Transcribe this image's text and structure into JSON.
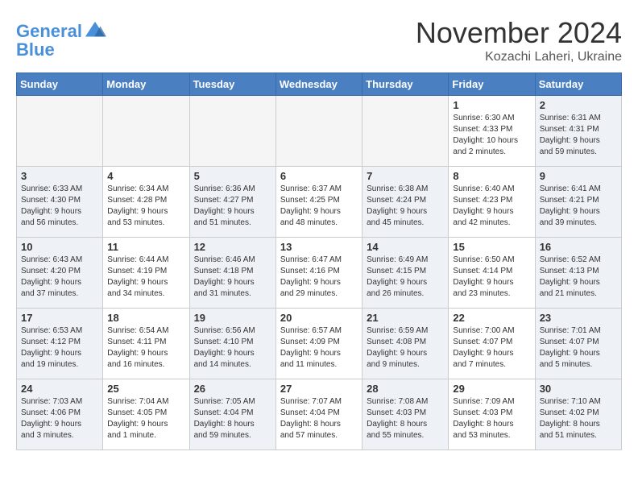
{
  "header": {
    "logo_line1": "General",
    "logo_line2": "Blue",
    "title": "November 2024",
    "subtitle": "Kozachi Laheri, Ukraine"
  },
  "weekdays": [
    "Sunday",
    "Monday",
    "Tuesday",
    "Wednesday",
    "Thursday",
    "Friday",
    "Saturday"
  ],
  "weeks": [
    [
      {
        "day": "",
        "empty": true
      },
      {
        "day": "",
        "empty": true
      },
      {
        "day": "",
        "empty": true
      },
      {
        "day": "",
        "empty": true
      },
      {
        "day": "",
        "empty": true
      },
      {
        "day": "1",
        "line1": "Sunrise: 6:30 AM",
        "line2": "Sunset: 4:33 PM",
        "line3": "Daylight: 10 hours",
        "line4": "and 2 minutes."
      },
      {
        "day": "2",
        "line1": "Sunrise: 6:31 AM",
        "line2": "Sunset: 4:31 PM",
        "line3": "Daylight: 9 hours",
        "line4": "and 59 minutes."
      }
    ],
    [
      {
        "day": "3",
        "line1": "Sunrise: 6:33 AM",
        "line2": "Sunset: 4:30 PM",
        "line3": "Daylight: 9 hours",
        "line4": "and 56 minutes."
      },
      {
        "day": "4",
        "line1": "Sunrise: 6:34 AM",
        "line2": "Sunset: 4:28 PM",
        "line3": "Daylight: 9 hours",
        "line4": "and 53 minutes."
      },
      {
        "day": "5",
        "line1": "Sunrise: 6:36 AM",
        "line2": "Sunset: 4:27 PM",
        "line3": "Daylight: 9 hours",
        "line4": "and 51 minutes."
      },
      {
        "day": "6",
        "line1": "Sunrise: 6:37 AM",
        "line2": "Sunset: 4:25 PM",
        "line3": "Daylight: 9 hours",
        "line4": "and 48 minutes."
      },
      {
        "day": "7",
        "line1": "Sunrise: 6:38 AM",
        "line2": "Sunset: 4:24 PM",
        "line3": "Daylight: 9 hours",
        "line4": "and 45 minutes."
      },
      {
        "day": "8",
        "line1": "Sunrise: 6:40 AM",
        "line2": "Sunset: 4:23 PM",
        "line3": "Daylight: 9 hours",
        "line4": "and 42 minutes."
      },
      {
        "day": "9",
        "line1": "Sunrise: 6:41 AM",
        "line2": "Sunset: 4:21 PM",
        "line3": "Daylight: 9 hours",
        "line4": "and 39 minutes."
      }
    ],
    [
      {
        "day": "10",
        "line1": "Sunrise: 6:43 AM",
        "line2": "Sunset: 4:20 PM",
        "line3": "Daylight: 9 hours",
        "line4": "and 37 minutes."
      },
      {
        "day": "11",
        "line1": "Sunrise: 6:44 AM",
        "line2": "Sunset: 4:19 PM",
        "line3": "Daylight: 9 hours",
        "line4": "and 34 minutes."
      },
      {
        "day": "12",
        "line1": "Sunrise: 6:46 AM",
        "line2": "Sunset: 4:18 PM",
        "line3": "Daylight: 9 hours",
        "line4": "and 31 minutes."
      },
      {
        "day": "13",
        "line1": "Sunrise: 6:47 AM",
        "line2": "Sunset: 4:16 PM",
        "line3": "Daylight: 9 hours",
        "line4": "and 29 minutes."
      },
      {
        "day": "14",
        "line1": "Sunrise: 6:49 AM",
        "line2": "Sunset: 4:15 PM",
        "line3": "Daylight: 9 hours",
        "line4": "and 26 minutes."
      },
      {
        "day": "15",
        "line1": "Sunrise: 6:50 AM",
        "line2": "Sunset: 4:14 PM",
        "line3": "Daylight: 9 hours",
        "line4": "and 23 minutes."
      },
      {
        "day": "16",
        "line1": "Sunrise: 6:52 AM",
        "line2": "Sunset: 4:13 PM",
        "line3": "Daylight: 9 hours",
        "line4": "and 21 minutes."
      }
    ],
    [
      {
        "day": "17",
        "line1": "Sunrise: 6:53 AM",
        "line2": "Sunset: 4:12 PM",
        "line3": "Daylight: 9 hours",
        "line4": "and 19 minutes."
      },
      {
        "day": "18",
        "line1": "Sunrise: 6:54 AM",
        "line2": "Sunset: 4:11 PM",
        "line3": "Daylight: 9 hours",
        "line4": "and 16 minutes."
      },
      {
        "day": "19",
        "line1": "Sunrise: 6:56 AM",
        "line2": "Sunset: 4:10 PM",
        "line3": "Daylight: 9 hours",
        "line4": "and 14 minutes."
      },
      {
        "day": "20",
        "line1": "Sunrise: 6:57 AM",
        "line2": "Sunset: 4:09 PM",
        "line3": "Daylight: 9 hours",
        "line4": "and 11 minutes."
      },
      {
        "day": "21",
        "line1": "Sunrise: 6:59 AM",
        "line2": "Sunset: 4:08 PM",
        "line3": "Daylight: 9 hours",
        "line4": "and 9 minutes."
      },
      {
        "day": "22",
        "line1": "Sunrise: 7:00 AM",
        "line2": "Sunset: 4:07 PM",
        "line3": "Daylight: 9 hours",
        "line4": "and 7 minutes."
      },
      {
        "day": "23",
        "line1": "Sunrise: 7:01 AM",
        "line2": "Sunset: 4:07 PM",
        "line3": "Daylight: 9 hours",
        "line4": "and 5 minutes."
      }
    ],
    [
      {
        "day": "24",
        "line1": "Sunrise: 7:03 AM",
        "line2": "Sunset: 4:06 PM",
        "line3": "Daylight: 9 hours",
        "line4": "and 3 minutes."
      },
      {
        "day": "25",
        "line1": "Sunrise: 7:04 AM",
        "line2": "Sunset: 4:05 PM",
        "line3": "Daylight: 9 hours",
        "line4": "and 1 minute."
      },
      {
        "day": "26",
        "line1": "Sunrise: 7:05 AM",
        "line2": "Sunset: 4:04 PM",
        "line3": "Daylight: 8 hours",
        "line4": "and 59 minutes."
      },
      {
        "day": "27",
        "line1": "Sunrise: 7:07 AM",
        "line2": "Sunset: 4:04 PM",
        "line3": "Daylight: 8 hours",
        "line4": "and 57 minutes."
      },
      {
        "day": "28",
        "line1": "Sunrise: 7:08 AM",
        "line2": "Sunset: 4:03 PM",
        "line3": "Daylight: 8 hours",
        "line4": "and 55 minutes."
      },
      {
        "day": "29",
        "line1": "Sunrise: 7:09 AM",
        "line2": "Sunset: 4:03 PM",
        "line3": "Daylight: 8 hours",
        "line4": "and 53 minutes."
      },
      {
        "day": "30",
        "line1": "Sunrise: 7:10 AM",
        "line2": "Sunset: 4:02 PM",
        "line3": "Daylight: 8 hours",
        "line4": "and 51 minutes."
      }
    ]
  ]
}
